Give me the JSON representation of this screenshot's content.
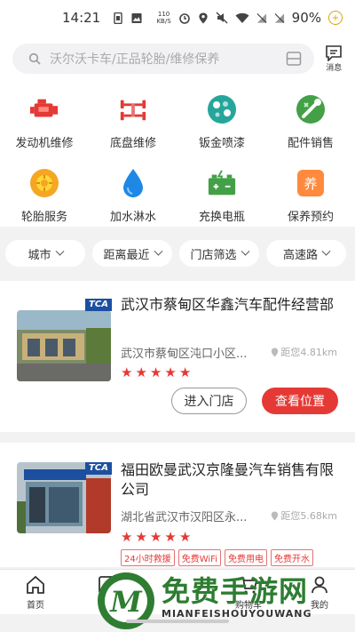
{
  "status_bar": {
    "time": "14:21",
    "net_speed_value": "110",
    "net_speed_unit": "KB/S",
    "battery": "90%"
  },
  "search": {
    "placeholder": "沃尔沃卡车/正品轮胎/维修保养",
    "message_label": "消息"
  },
  "services": [
    {
      "label": "发动机维修",
      "icon": "engine-icon",
      "color": "#e53935"
    },
    {
      "label": "底盘维修",
      "icon": "chassis-icon",
      "color": "#e53935"
    },
    {
      "label": "钣金喷漆",
      "icon": "paint-icon",
      "color": "#26a69a"
    },
    {
      "label": "配件销售",
      "icon": "parts-icon",
      "color": "#43a047"
    },
    {
      "label": "轮胎服务",
      "icon": "tire-icon",
      "color": "#f5a623"
    },
    {
      "label": "加水淋水",
      "icon": "water-icon",
      "color": "#1e88e5"
    },
    {
      "label": "充换电瓶",
      "icon": "battery-icon",
      "color": "#43a047"
    },
    {
      "label": "保养预约",
      "icon": "maintenance-icon",
      "color": "#ff8a3d"
    }
  ],
  "services_extra": {
    "maintenance_glyph": "养"
  },
  "filters": [
    "城市",
    "距离最近",
    "门店筛选",
    "高速路"
  ],
  "stores": [
    {
      "badge": "TCA",
      "name": "武汉市蔡甸区华鑫汽车配件经营部",
      "address": "武汉市蔡甸区沌口小区...",
      "distance": "距您4.81km",
      "rating": 5,
      "enter_label": "进入门店",
      "location_label": "查看位置"
    },
    {
      "badge": "TCA",
      "name": "福田欧曼武汉京隆曼汽车销售有限公司",
      "address": "湖北省武汉市汉阳区永...",
      "distance": "距您5.68km",
      "rating": 5,
      "tags": [
        "24小时救援",
        "免费WiFi",
        "免费用电",
        "免费开水"
      ]
    }
  ],
  "bottom_nav": [
    "首页",
    "订",
    "购物车",
    "我的"
  ],
  "watermark": {
    "title": "免费手游网",
    "sub": "MIANFEISHOUYOUWANG"
  },
  "colors": {
    "accent": "#e53935",
    "tag_border": "#e57373"
  }
}
